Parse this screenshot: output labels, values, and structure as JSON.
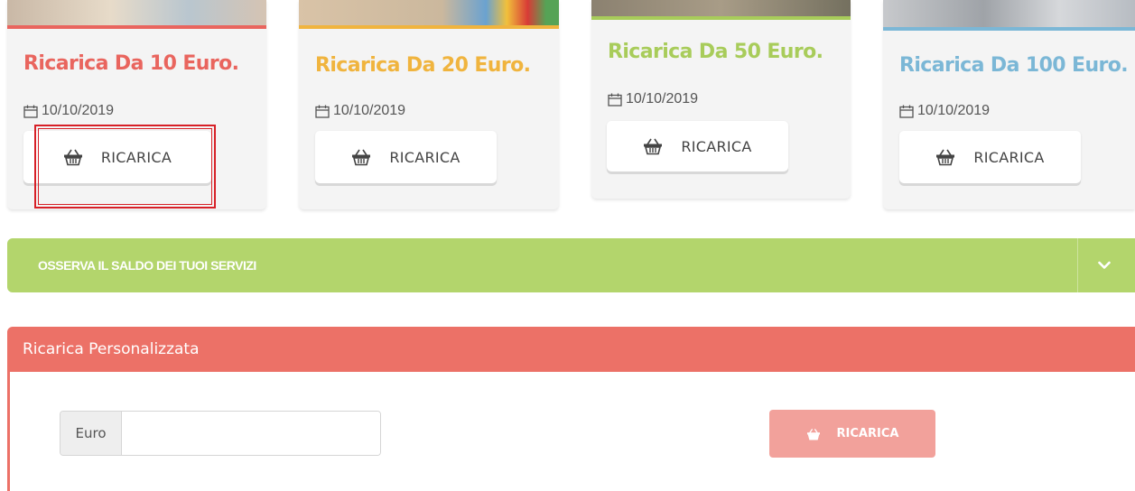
{
  "cards": [
    {
      "title": "Ricarica Da 10 Euro.",
      "date": "10/10/2019",
      "button_label": "RICARICA",
      "accent": "#e9655e"
    },
    {
      "title": "Ricarica Da 20 Euro.",
      "date": "10/10/2019",
      "button_label": "RICARICA",
      "accent": "#f0b43e"
    },
    {
      "title": "Ricarica Da 50 Euro.",
      "date": "10/10/2019",
      "button_label": "RICARICA",
      "accent": "#a8cc5a"
    },
    {
      "title": "Ricarica Da 100 Euro.",
      "date": "10/10/2019",
      "button_label": "RICARICA",
      "accent": "#7bb7d6"
    }
  ],
  "services_accordion": {
    "title": "OSSERVA IL SALDO DEI TUOI SERVIZI",
    "color": "#b3d56c"
  },
  "custom_recharge": {
    "title": "Ricarica Personalizzata",
    "input_addon": "Euro",
    "input_value": "",
    "button_label": "RICARICA",
    "header_color": "#ec7167",
    "button_color": "#f2a19b"
  },
  "icons": {
    "date": "calendar-icon",
    "button": "basket-icon",
    "toggle": "chevron-down-icon"
  }
}
